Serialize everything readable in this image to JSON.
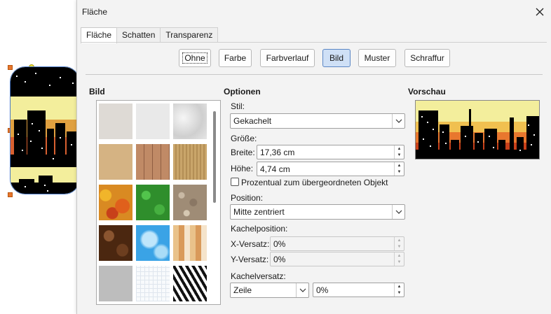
{
  "dialog": {
    "title": "Fläche",
    "close_icon": "close-icon"
  },
  "tabs": [
    {
      "label": "Fläche",
      "active": true
    },
    {
      "label": "Schatten",
      "active": false
    },
    {
      "label": "Transparenz",
      "active": false
    }
  ],
  "fill_buttons": [
    {
      "label": "Ohne",
      "state": "focused"
    },
    {
      "label": "Farbe",
      "state": "normal"
    },
    {
      "label": "Farbverlauf",
      "state": "normal"
    },
    {
      "label": "Bild",
      "state": "selected"
    },
    {
      "label": "Muster",
      "state": "normal"
    },
    {
      "label": "Schraffur",
      "state": "normal"
    }
  ],
  "bild": {
    "heading": "Bild",
    "thumbnails": [
      {
        "name": "paper-texture-1"
      },
      {
        "name": "paper-texture-2"
      },
      {
        "name": "crumpled-paper"
      },
      {
        "name": "cardboard"
      },
      {
        "name": "wood-planks"
      },
      {
        "name": "straw"
      },
      {
        "name": "autumn-leaves"
      },
      {
        "name": "grass"
      },
      {
        "name": "pebbles"
      },
      {
        "name": "coffee-beans"
      },
      {
        "name": "sky-clouds"
      },
      {
        "name": "color-mosaic"
      },
      {
        "name": "concrete"
      },
      {
        "name": "grid-paper"
      },
      {
        "name": "zebra"
      }
    ]
  },
  "optionen": {
    "heading": "Optionen",
    "stil_label": "Stil:",
    "stil_value": "Gekachelt",
    "groesse_label": "Größe:",
    "breite_label": "Breite:",
    "breite_value": "17,36 cm",
    "hoehe_label": "Höhe:",
    "hoehe_value": "4,74 cm",
    "prozentual_label": "Prozentual zum übergeordneten Objekt",
    "prozentual_checked": false,
    "position_label": "Position:",
    "position_value": "Mitte zentriert",
    "kachelposition_label": "Kachelposition:",
    "x_versatz_label": "X-Versatz:",
    "x_versatz_value": "0%",
    "y_versatz_label": "Y-Versatz:",
    "y_versatz_value": "0%",
    "kachelversatz_label": "Kachelversatz:",
    "kachelversatz_mode": "Zeile",
    "kachelversatz_value": "0%"
  },
  "vorschau": {
    "heading": "Vorschau"
  },
  "colors": {
    "accent_selected": "#cfe0f6",
    "accent_border": "#5b86c4",
    "skyline_yellow": "#f3ee9c",
    "sunset_orange": "#e8772e",
    "handle_orange": "#e8772e"
  }
}
